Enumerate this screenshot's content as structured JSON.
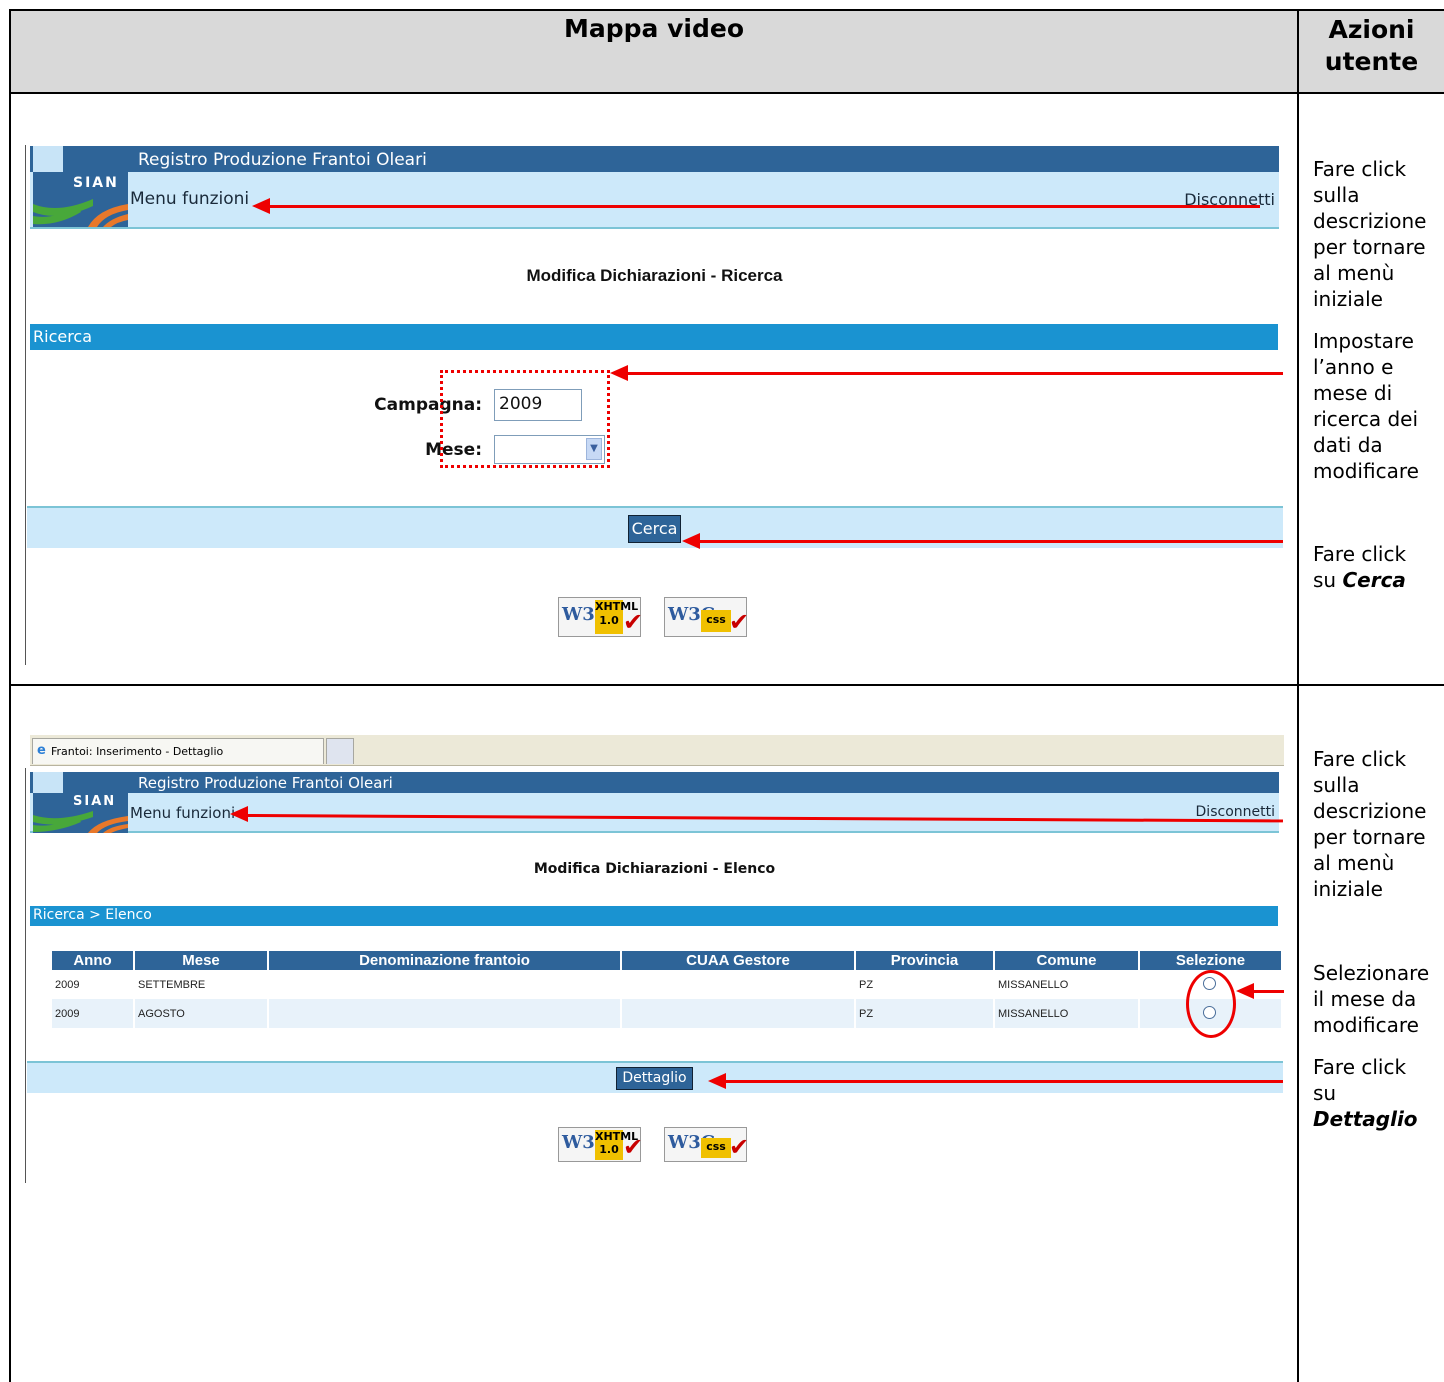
{
  "header": {
    "left_title": "Mappa video",
    "right_title_l1": "Azioni",
    "right_title_l2": "utente"
  },
  "screen1": {
    "app_title": "Registro Produzione Frantoi Oleari",
    "logo_text": "SIAN",
    "menu_link": "Menu funzioni",
    "logout_link": "Disconnetti",
    "page_heading": "Modifica Dichiarazioni - Ricerca",
    "section_label": "Ricerca",
    "campaign_label": "Campagna:",
    "campaign_value": "2009",
    "month_label": "Mese:",
    "month_value": "",
    "search_button": "Cerca",
    "badge_w3c": "W3C",
    "badge_xhtml": "XHTML",
    "badge_xhtml_ver": "1.0",
    "badge_css": "css"
  },
  "screen2": {
    "browser_tab": "Frantoi: Inserimento - Dettaglio",
    "app_title": "Registro Produzione Frantoi Oleari",
    "logo_text": "SIAN",
    "menu_link": "Menu funzioni",
    "logout_link": "Disconnetti",
    "page_heading": "Modifica Dichiarazioni - Elenco",
    "breadcrumb": "Ricerca > Elenco",
    "columns": [
      "Anno",
      "Mese",
      "Denominazione frantoio",
      "CUAA Gestore",
      "Provincia",
      "Comune",
      "Selezione"
    ],
    "rows": [
      {
        "anno": "2009",
        "mese": "SETTEMBRE",
        "frantoio": "",
        "cuaa": "",
        "provincia": "PZ",
        "comune": "MISSANELLO"
      },
      {
        "anno": "2009",
        "mese": "AGOSTO",
        "frantoio": "",
        "cuaa": "",
        "provincia": "PZ",
        "comune": "MISSANELLO"
      }
    ],
    "detail_button": "Dettaglio",
    "badge_w3c": "W3C",
    "badge_xhtml": "XHTML",
    "badge_xhtml_ver": "1.0",
    "badge_css": "css"
  },
  "actions": {
    "a1": [
      "Fare click",
      "sulla",
      "descrizione",
      "per tornare",
      "al menù",
      "iniziale"
    ],
    "a2": [
      "Impostare",
      "l’anno e",
      "mese di",
      "ricerca dei",
      "dati da",
      "modificare"
    ],
    "a3_l1": "Fare click",
    "a3_l2": "su",
    "a3_em": "Cerca",
    "a4": [
      "Fare click",
      "sulla",
      "descrizione",
      "per tornare",
      "al menù",
      "iniziale"
    ],
    "a5": [
      "Selezionare",
      "il mese da",
      "modificare"
    ],
    "a6_l1": "Fare click",
    "a6_l2": "su",
    "a6_em": "Dettaglio"
  },
  "colors": {
    "navy": "#2e6498",
    "light_blue": "#cde9fa",
    "section_blue": "#1a93d1",
    "arrow_red": "#e00000"
  }
}
